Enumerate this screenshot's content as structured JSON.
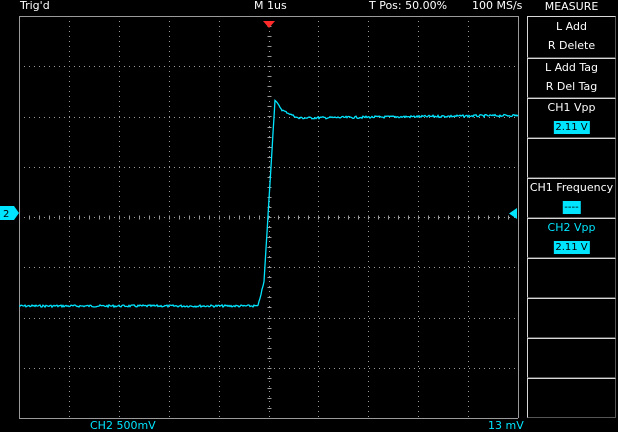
{
  "header": {
    "trigger_status": "Trig'd",
    "timebase": "M 1us",
    "trigger_position": "T Pos: 50.00%",
    "sample_rate": "100 MS/s"
  },
  "footer": {
    "channel_scale": "CH2 500mV",
    "offset": "13 mV"
  },
  "channel_marker": {
    "label": "2"
  },
  "colors": {
    "trace": "#00e5ff",
    "grid": "#9a9a9a",
    "trigger": "#ff2a2a",
    "background": "#000000"
  },
  "measure_menu": {
    "title": "MEASURE",
    "buttons": [
      {
        "line1": "L Add",
        "line2": "R Delete"
      },
      {
        "line1": "L Add Tag",
        "line2": "R Del Tag"
      },
      {
        "line1": "CH1 Vpp",
        "value": "2.11 V"
      },
      {
        "line1": ""
      },
      {
        "line1": "CH1 Frequency",
        "value": "----"
      },
      {
        "line1": "CH2 Vpp",
        "value": "2.11 V"
      },
      {
        "line1": ""
      },
      {
        "line1": ""
      },
      {
        "line1": ""
      },
      {
        "line1": ""
      }
    ]
  }
}
